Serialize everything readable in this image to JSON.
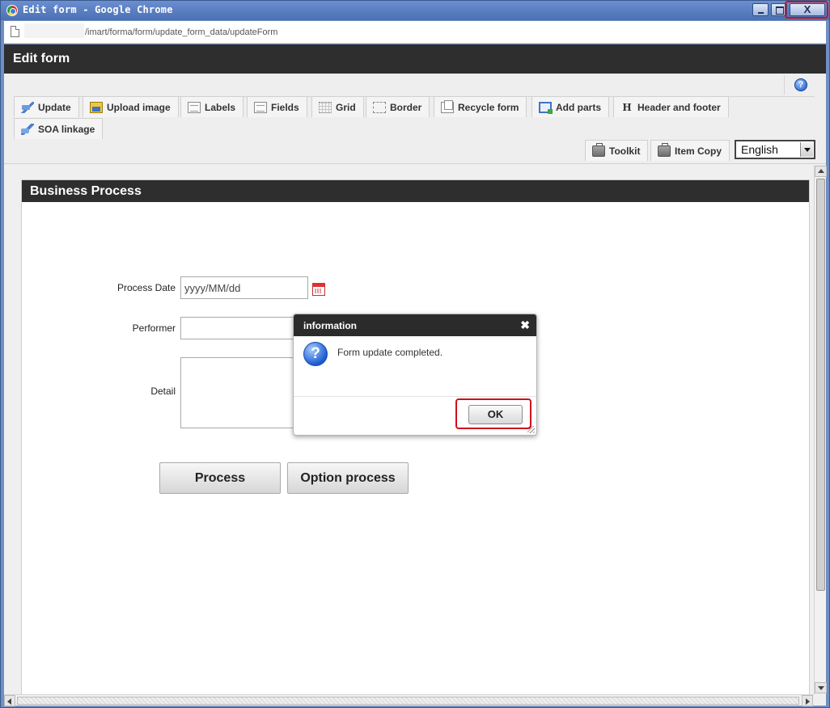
{
  "window": {
    "title": "Edit form - Google Chrome",
    "close_glyph": "X"
  },
  "address_bar": {
    "url": "/imart/forma/form/update_form_data/updateForm"
  },
  "app": {
    "title": "Edit form",
    "help_glyph": "?"
  },
  "toolbar": {
    "row1": [
      {
        "label": "Update",
        "icon": "update-icon"
      },
      {
        "label": "Upload image",
        "icon": "image-icon"
      },
      {
        "label": "Labels",
        "icon": "labels-icon"
      },
      {
        "label": "Fields",
        "icon": "fields-icon"
      },
      {
        "label": "Grid",
        "icon": "grid-icon"
      },
      {
        "label": "Border",
        "icon": "border-icon"
      },
      {
        "label": "Recycle form",
        "icon": "recycle-icon"
      },
      {
        "label": "Add parts",
        "icon": "add-parts-icon"
      },
      {
        "label": "Header and footer",
        "icon": "header-footer-icon"
      }
    ],
    "row2": [
      {
        "label": "SOA linkage",
        "icon": "soa-icon"
      }
    ],
    "right": [
      {
        "label": "Toolkit",
        "icon": "toolbox-icon"
      },
      {
        "label": "Item Copy",
        "icon": "toolbox-icon"
      }
    ],
    "language": "English",
    "h_glyph": "H"
  },
  "form": {
    "panel_title": "Business Process",
    "process_date_label": "Process Date",
    "process_date_placeholder": "yyyy/MM/dd",
    "performer_label": "Performer",
    "detail_label": "Detail",
    "process_button": "Process",
    "option_process_button": "Option process"
  },
  "dialog": {
    "title": "information",
    "close_glyph": "✖",
    "icon_glyph": "?",
    "message": "Form update completed.",
    "ok_label": "OK"
  },
  "colors": {
    "header_bg": "#2e2e2e",
    "highlight": "#d0101b",
    "titlebar": "#4a6fb3"
  }
}
